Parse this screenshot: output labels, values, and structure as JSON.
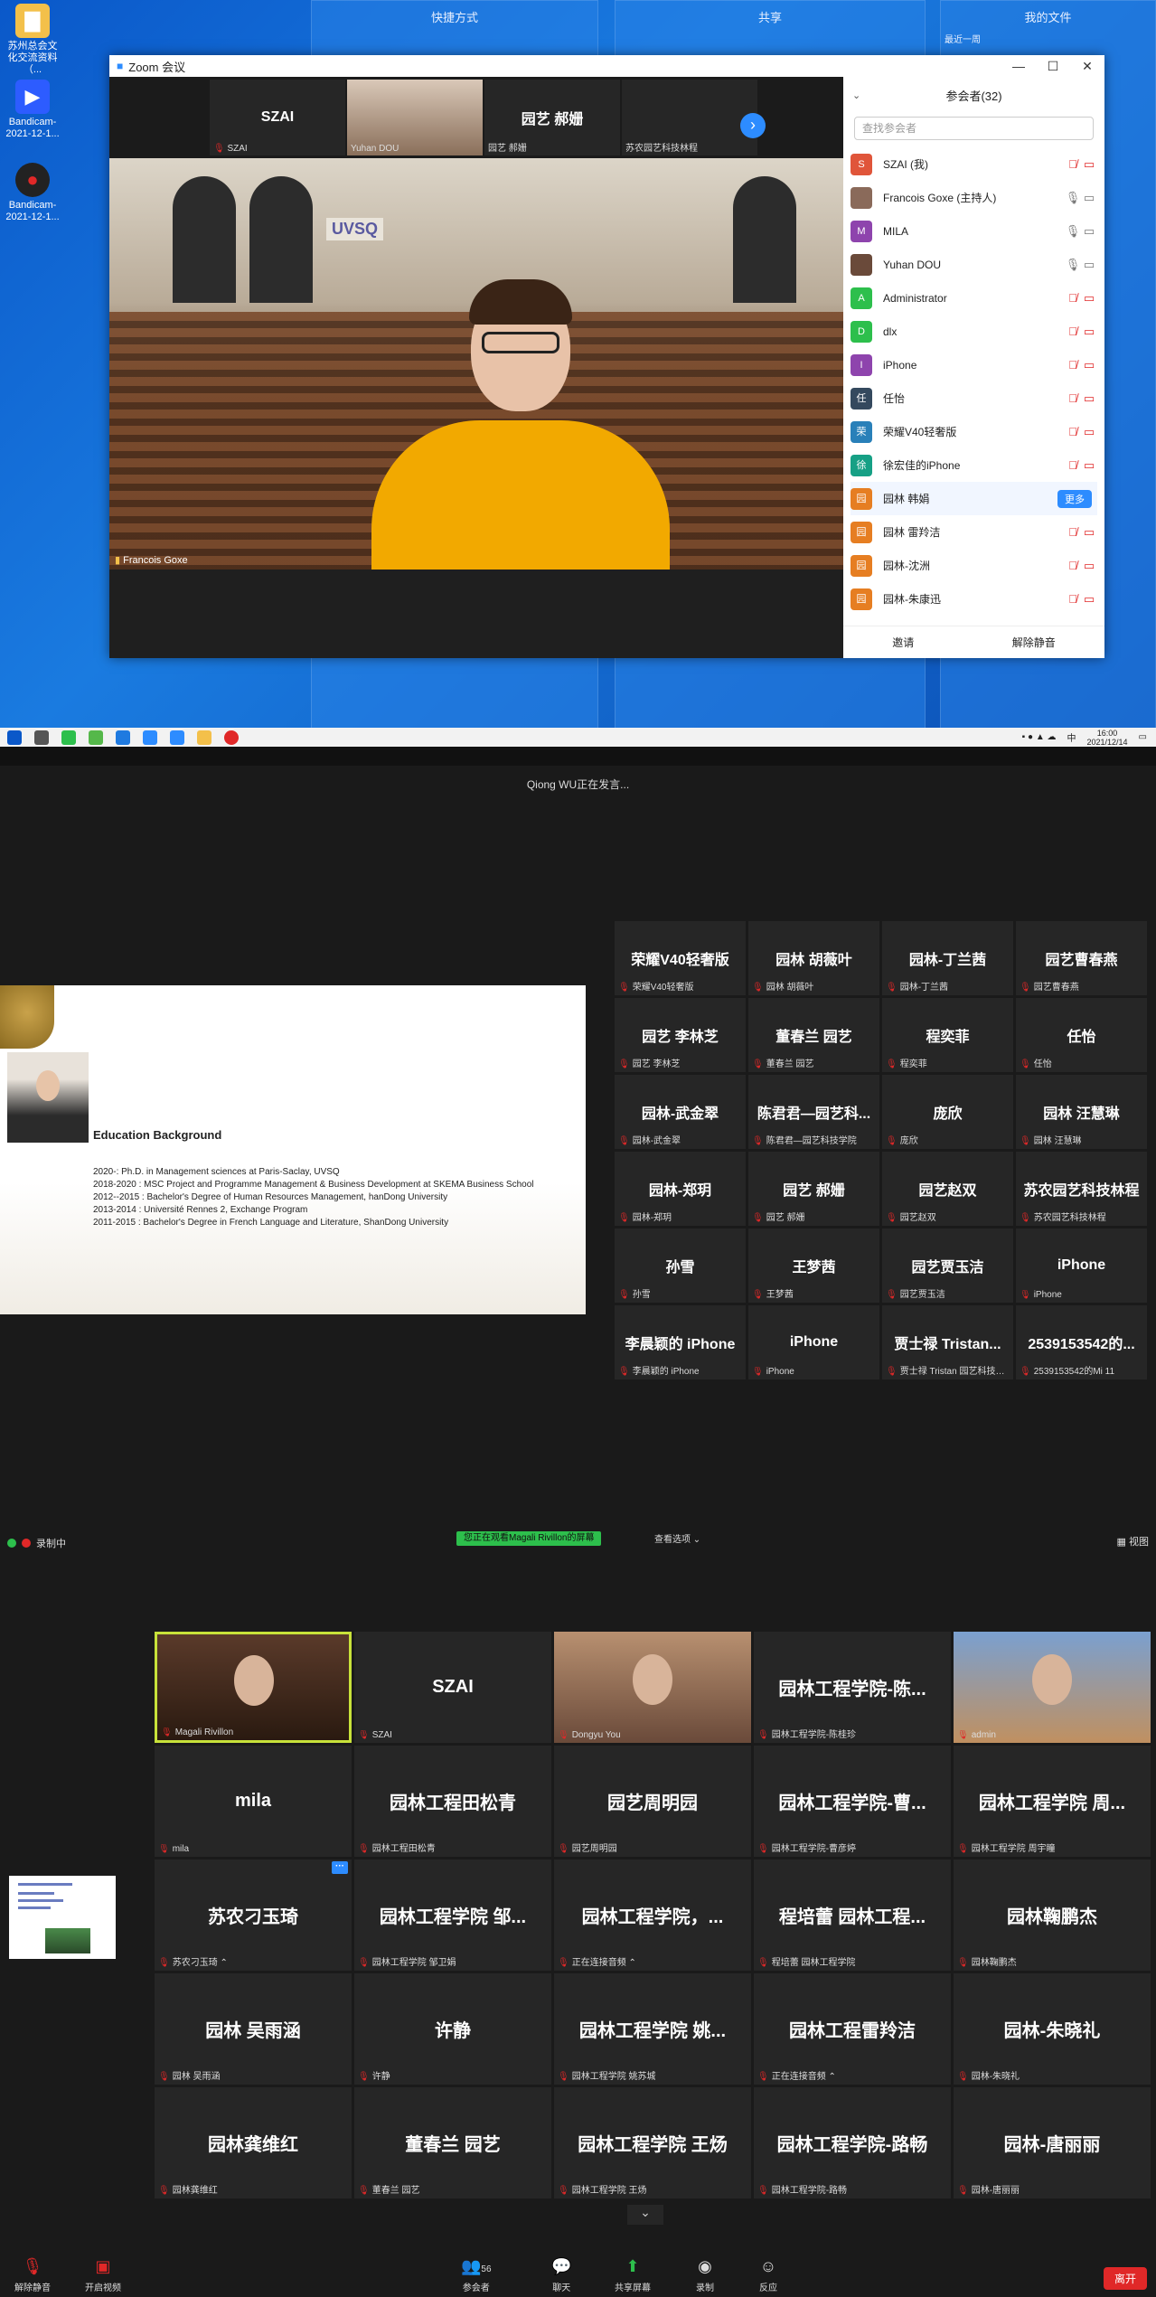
{
  "desktop": {
    "panels": [
      {
        "title": "快捷方式"
      },
      {
        "title": "共享"
      },
      {
        "title": "我的文件",
        "sub": "最近一周"
      }
    ],
    "icons": [
      {
        "label": "苏州总会文化交流资料（..."
      },
      {
        "label": "Bandicam-2021-12-1..."
      },
      {
        "label": "Bandicam-2021-12-1..."
      }
    ]
  },
  "zoom_window": {
    "title": "Zoom 会议",
    "thumbs": [
      {
        "big": "SZAI",
        "label": "SZAI"
      },
      {
        "big": "",
        "label": "Yuhan DOU"
      },
      {
        "big": "园艺 郝姗",
        "label": "园艺 郝姗"
      },
      {
        "big": "",
        "label": "苏农园艺科技林程"
      }
    ],
    "main_speaker": "Francois Goxe",
    "slide_banner": "UVSQ",
    "participants": {
      "title": "参会者(32)",
      "search_placeholder": "查找参会者",
      "items": [
        {
          "av": "S",
          "color": "#e0553a",
          "name": "SZAI (我)",
          "mic": "muted"
        },
        {
          "av": "",
          "color": "#8a6a5a",
          "name": "Francois Goxe (主持人)",
          "mic": "on"
        },
        {
          "av": "M",
          "color": "#8e44ad",
          "name": "MILA",
          "mic": "off"
        },
        {
          "av": "",
          "color": "#6a4a3a",
          "name": "Yuhan DOU",
          "mic": "on"
        },
        {
          "av": "A",
          "color": "#2dbf4c",
          "name": "Administrator",
          "mic": "muted"
        },
        {
          "av": "D",
          "color": "#2dbf4c",
          "name": "dlx",
          "mic": "muted"
        },
        {
          "av": "I",
          "color": "#8e44ad",
          "name": "iPhone",
          "mic": "muted"
        },
        {
          "av": "任",
          "color": "#34495e",
          "name": "任怡",
          "mic": "muted"
        },
        {
          "av": "荣",
          "color": "#2980b9",
          "name": "荣耀V40轻奢版",
          "mic": "muted"
        },
        {
          "av": "徐",
          "color": "#16a085",
          "name": "徐宏佳的iPhone",
          "mic": "muted"
        },
        {
          "av": "园",
          "color": "#e67e22",
          "name": "园林 韩娟",
          "mic": "muted",
          "more": "更多"
        },
        {
          "av": "园",
          "color": "#e67e22",
          "name": "园林 雷羚洁",
          "mic": "muted"
        },
        {
          "av": "园",
          "color": "#e67e22",
          "name": "园林-沈洲",
          "mic": "muted"
        },
        {
          "av": "园",
          "color": "#e67e22",
          "name": "园林-朱康迅",
          "mic": "muted"
        }
      ],
      "invite": "邀请",
      "unmute_all": "解除静音"
    }
  },
  "taskbar": {
    "time": "16:00",
    "date": "2021/12/14",
    "lang": "中"
  },
  "section2": {
    "speaking": "Qiong WU正在发言...",
    "slide": {
      "title": "Education Background",
      "lines": [
        "2020-: Ph.D. in Management sciences at Paris-Saclay, UVSQ",
        "2018-2020 : MSC Project and Programme Management & Business Development at SKEMA Business School",
        "2012--2015 : Bachelor's Degree of Human Resources Management, hanDong University",
        "2013-2014 : Université Rennes 2, Exchange Program",
        "2011-2015 : Bachelor's Degree in French Language and Literature, ShanDong University"
      ]
    },
    "tiles": [
      {
        "big": "荣耀V40轻奢版",
        "label": "荣耀V40轻奢版"
      },
      {
        "big": "园林 胡薇叶",
        "label": "园林 胡薇叶"
      },
      {
        "big": "园林-丁兰茜",
        "label": "园林-丁兰茜"
      },
      {
        "big": "园艺曹春燕",
        "label": "园艺曹春燕"
      },
      {
        "big": "园艺 李林芝",
        "label": "园艺 李林芝"
      },
      {
        "big": "董春兰  园艺",
        "label": "董春兰  园艺"
      },
      {
        "big": "程奕菲",
        "label": "程奕菲"
      },
      {
        "big": "任怡",
        "label": "任怡"
      },
      {
        "big": "园林-武金翠",
        "label": "园林-武金翠"
      },
      {
        "big": "陈君君—园艺科...",
        "label": "陈君君—园艺科技学院"
      },
      {
        "big": "庞欣",
        "label": "庞欣"
      },
      {
        "big": "园林 汪慧琳",
        "label": "园林 汪慧琳"
      },
      {
        "big": "园林-郑玥",
        "label": "园林-郑玥"
      },
      {
        "big": "园艺 郝姗",
        "label": "园艺 郝姗"
      },
      {
        "big": "园艺赵双",
        "label": "园艺赵双"
      },
      {
        "big": "苏农园艺科技林程",
        "label": "苏农园艺科技林程"
      },
      {
        "big": "孙雪",
        "label": "孙雪"
      },
      {
        "big": "王梦茜",
        "label": "王梦茜"
      },
      {
        "big": "园艺贾玉洁",
        "label": "园艺贾玉洁"
      },
      {
        "big": "iPhone",
        "label": "iPhone"
      },
      {
        "big": "李晨颖的 iPhone",
        "label": "李晨颖的 iPhone"
      },
      {
        "big": "iPhone",
        "label": "iPhone"
      },
      {
        "big": "贾士禄 Tristan...",
        "label": "贾士禄 Tristan 园艺科技学..."
      },
      {
        "big": "2539153542的...",
        "label": "2539153542的Mi 11"
      }
    ]
  },
  "section3": {
    "recording": "录制中",
    "share_banner": "您正在观看Magali Rivillon的屏幕",
    "view_options": "查看选项",
    "view": "视图",
    "tiles": [
      {
        "big": "",
        "label": "Magali Rivillon",
        "video": "vid1",
        "active": true
      },
      {
        "big": "SZAI",
        "label": "SZAI"
      },
      {
        "big": "",
        "label": "Dongyu You",
        "video": "vid2"
      },
      {
        "big": "园林工程学院-陈...",
        "label": "园林工程学院-陈桂珍"
      },
      {
        "big": "",
        "label": "admin",
        "video": "vid3"
      },
      {
        "big": "mila",
        "label": "mila"
      },
      {
        "big": "园林工程田松青",
        "label": "园林工程田松青"
      },
      {
        "big": "园艺周明园",
        "label": "园艺周明园"
      },
      {
        "big": "园林工程学院-曹...",
        "label": "园林工程学院-曹彦婷"
      },
      {
        "big": "园林工程学院 周...",
        "label": "园林工程学院 周宇瞳"
      },
      {
        "big": "苏农刁玉琦",
        "label": "苏农刁玉琦 ⌃",
        "badge": true
      },
      {
        "big": "园林工程学院 邹...",
        "label": "园林工程学院 邹卫娟"
      },
      {
        "big": "园林工程学院，...",
        "label": "正在连接音频 ⌃"
      },
      {
        "big": "程培蕾 园林工程...",
        "label": "程培蕾 园林工程学院"
      },
      {
        "big": "园林鞠鹏杰",
        "label": "园林鞠鹏杰"
      },
      {
        "big": "园林 吴雨涵",
        "label": "园林 吴雨涵"
      },
      {
        "big": "许静",
        "label": "许静"
      },
      {
        "big": "园林工程学院 姚...",
        "label": "园林工程学院 姚苏城"
      },
      {
        "big": "园林工程雷羚洁",
        "label": "正在连接音频 ⌃"
      },
      {
        "big": "园林-朱晓礼",
        "label": "园林-朱晓礼"
      },
      {
        "big": "园林龚维红",
        "label": "园林龚维红"
      },
      {
        "big": "董春兰  园艺",
        "label": "董春兰  园艺"
      },
      {
        "big": "园林工程学院 王炀",
        "label": "园林工程学院 王炀"
      },
      {
        "big": "园林工程学院-路畅",
        "label": "园林工程学院-路畅"
      },
      {
        "big": "园林-唐丽丽",
        "label": "园林-唐丽丽"
      }
    ],
    "controls": [
      {
        "label": "解除静音"
      },
      {
        "label": "开启视频"
      },
      {
        "label": "参会者",
        "count": "56"
      },
      {
        "label": "聊天"
      },
      {
        "label": "共享屏幕"
      },
      {
        "label": "录制"
      },
      {
        "label": "反应"
      }
    ],
    "leave": "离开"
  }
}
